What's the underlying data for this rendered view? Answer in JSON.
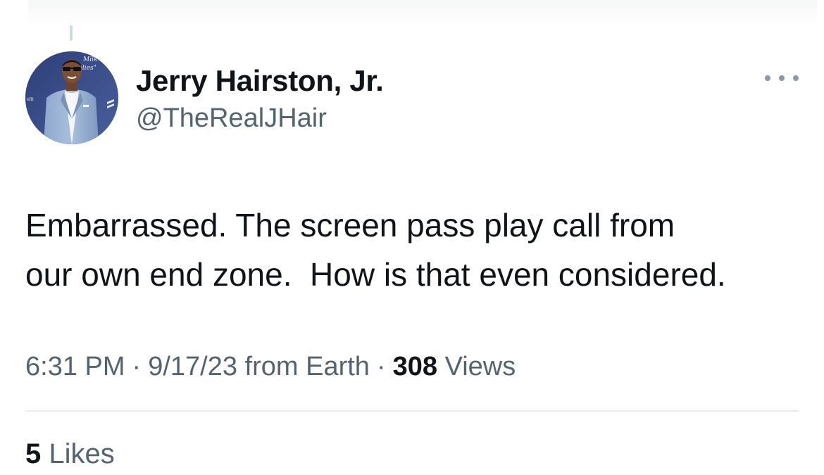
{
  "tweet": {
    "author": {
      "display_name": "Jerry Hairston, Jr.",
      "handle": "@TheRealJHair",
      "avatar": "avatar-photo"
    },
    "more_icon": "more-horizontal-icon",
    "text_line_1": "Embarrassed. The screen pass play call from",
    "text_line_2": "our own end zone.  How is that even considered.",
    "time": "6:31 PM",
    "separator": "·",
    "date": "9/17/23",
    "source": "from Earth",
    "views_count": "308",
    "views_label": "Views",
    "likes_count": "5",
    "likes_label": "Likes"
  },
  "colors": {
    "text_primary": "#0f1419",
    "text_secondary": "#536471",
    "divider": "#e7ebed",
    "background": "#ffffff"
  }
}
